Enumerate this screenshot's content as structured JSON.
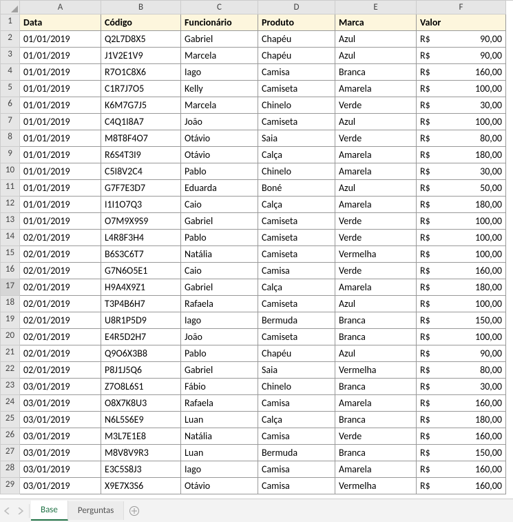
{
  "columns": [
    "A",
    "B",
    "C",
    "D",
    "E",
    "F"
  ],
  "rowNumbers": [
    1,
    2,
    3,
    4,
    5,
    6,
    7,
    8,
    9,
    10,
    11,
    12,
    13,
    14,
    15,
    16,
    17,
    18,
    19,
    20,
    21,
    22,
    23,
    24,
    25,
    26,
    27,
    28,
    29
  ],
  "selectedRowHeader": 17,
  "headers": {
    "data": "Data",
    "codigo": "Código",
    "funcionario": "Funcionário",
    "produto": "Produto",
    "marca": "Marca",
    "valor": "Valor"
  },
  "currency": "R$",
  "rows": [
    {
      "data": "01/01/2019",
      "codigo": "Q2L7D8X5",
      "func": "Gabriel",
      "prod": "Chapéu",
      "marca": "Azul",
      "valor": "90,00"
    },
    {
      "data": "01/01/2019",
      "codigo": "J1V2E1V9",
      "func": "Marcela",
      "prod": "Chapéu",
      "marca": "Azul",
      "valor": "90,00"
    },
    {
      "data": "01/01/2019",
      "codigo": "R7O1C8X6",
      "func": "Iago",
      "prod": "Camisa",
      "marca": "Branca",
      "valor": "160,00"
    },
    {
      "data": "01/01/2019",
      "codigo": "C1R7J7O5",
      "func": "Kelly",
      "prod": "Camiseta",
      "marca": "Amarela",
      "valor": "100,00"
    },
    {
      "data": "01/01/2019",
      "codigo": "K6M7G7J5",
      "func": "Marcela",
      "prod": "Chinelo",
      "marca": "Verde",
      "valor": "30,00"
    },
    {
      "data": "01/01/2019",
      "codigo": "C4Q1I8A7",
      "func": "João",
      "prod": "Camiseta",
      "marca": "Azul",
      "valor": "100,00"
    },
    {
      "data": "01/01/2019",
      "codigo": "M8T8F4O7",
      "func": "Otávio",
      "prod": "Saia",
      "marca": "Verde",
      "valor": "80,00"
    },
    {
      "data": "01/01/2019",
      "codigo": "R6S4T3I9",
      "func": "Otávio",
      "prod": "Calça",
      "marca": "Amarela",
      "valor": "180,00"
    },
    {
      "data": "01/01/2019",
      "codigo": "C5I8V2C4",
      "func": "Pablo",
      "prod": "Chinelo",
      "marca": "Amarela",
      "valor": "30,00"
    },
    {
      "data": "01/01/2019",
      "codigo": "G7F7E3D7",
      "func": "Eduarda",
      "prod": "Boné",
      "marca": "Azul",
      "valor": "50,00"
    },
    {
      "data": "01/01/2019",
      "codigo": "I1I1O7Q3",
      "func": "Caio",
      "prod": "Calça",
      "marca": "Amarela",
      "valor": "180,00"
    },
    {
      "data": "01/01/2019",
      "codigo": "O7M9X9S9",
      "func": "Gabriel",
      "prod": "Camiseta",
      "marca": "Verde",
      "valor": "100,00"
    },
    {
      "data": "02/01/2019",
      "codigo": "L4R8F3H4",
      "func": "Pablo",
      "prod": "Camiseta",
      "marca": "Verde",
      "valor": "100,00"
    },
    {
      "data": "02/01/2019",
      "codigo": "B6S3C6T7",
      "func": "Natália",
      "prod": "Camiseta",
      "marca": "Vermelha",
      "valor": "100,00"
    },
    {
      "data": "02/01/2019",
      "codigo": "G7N6O5E1",
      "func": "Caio",
      "prod": "Camisa",
      "marca": "Verde",
      "valor": "160,00"
    },
    {
      "data": "02/01/2019",
      "codigo": "H9A4X9Z1",
      "func": "Gabriel",
      "prod": "Calça",
      "marca": "Amarela",
      "valor": "180,00"
    },
    {
      "data": "02/01/2019",
      "codigo": "T3P4B6H7",
      "func": "Rafaela",
      "prod": "Camiseta",
      "marca": "Azul",
      "valor": "100,00"
    },
    {
      "data": "02/01/2019",
      "codigo": "U8R1P5D9",
      "func": "Iago",
      "prod": "Bermuda",
      "marca": "Branca",
      "valor": "150,00"
    },
    {
      "data": "02/01/2019",
      "codigo": "E4R5D2H7",
      "func": "João",
      "prod": "Camiseta",
      "marca": "Branca",
      "valor": "100,00"
    },
    {
      "data": "02/01/2019",
      "codigo": "Q9O6X3B8",
      "func": "Pablo",
      "prod": "Chapéu",
      "marca": "Azul",
      "valor": "90,00"
    },
    {
      "data": "02/01/2019",
      "codigo": "P8J1J5Q6",
      "func": "Gabriel",
      "prod": "Saia",
      "marca": "Vermelha",
      "valor": "80,00"
    },
    {
      "data": "03/01/2019",
      "codigo": "Z7O8L6S1",
      "func": "Fábio",
      "prod": "Chinelo",
      "marca": "Branca",
      "valor": "30,00"
    },
    {
      "data": "03/01/2019",
      "codigo": "O8X7K8U3",
      "func": "Rafaela",
      "prod": "Camisa",
      "marca": "Amarela",
      "valor": "160,00"
    },
    {
      "data": "03/01/2019",
      "codigo": "N6L5S6E9",
      "func": "Luan",
      "prod": "Calça",
      "marca": "Branca",
      "valor": "180,00"
    },
    {
      "data": "03/01/2019",
      "codigo": "M3L7E1E8",
      "func": "Natália",
      "prod": "Camisa",
      "marca": "Verde",
      "valor": "160,00"
    },
    {
      "data": "03/01/2019",
      "codigo": "M8V8V9R3",
      "func": "Luan",
      "prod": "Bermuda",
      "marca": "Branca",
      "valor": "150,00"
    },
    {
      "data": "03/01/2019",
      "codigo": "E3C5S8J3",
      "func": "Iago",
      "prod": "Camisa",
      "marca": "Amarela",
      "valor": "160,00"
    },
    {
      "data": "03/01/2019",
      "codigo": "X9E7X3S6",
      "func": "Otávio",
      "prod": "Camisa",
      "marca": "Vermelha",
      "valor": "160,00"
    }
  ],
  "tabs": {
    "active": "Base",
    "other": "Perguntas"
  }
}
